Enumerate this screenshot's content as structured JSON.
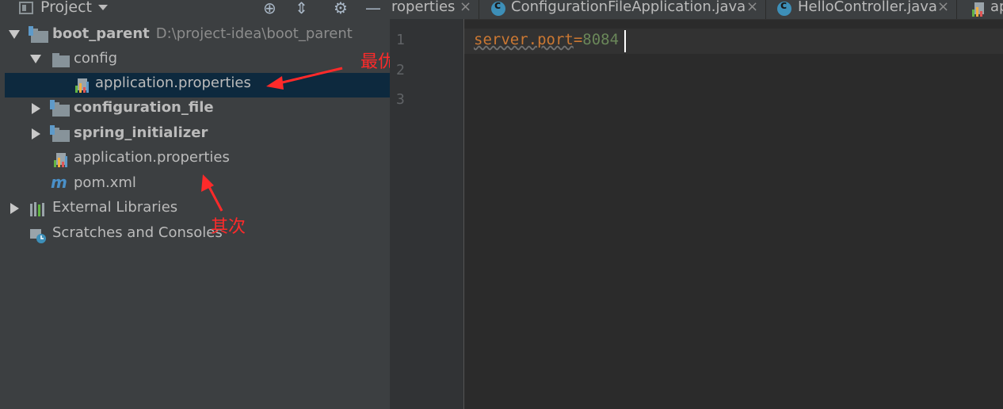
{
  "panel": {
    "title": "Project",
    "tools": [
      "locate-icon",
      "collapse-icon",
      "gear-icon",
      "minimize-icon"
    ]
  },
  "tree": [
    {
      "label": "boot_parent",
      "path": "D:\\project-idea\\boot_parent",
      "bold": true,
      "expanded": true,
      "icon": "module-folder-icon"
    },
    {
      "label": "config",
      "bold": false,
      "expanded": true,
      "icon": "folder-icon"
    },
    {
      "label": "application.properties",
      "selected": true,
      "icon": "properties-file-icon"
    },
    {
      "label": "configuration_file",
      "bold": true,
      "expanded": false,
      "icon": "module-folder-icon"
    },
    {
      "label": "spring_initializer",
      "bold": true,
      "expanded": false,
      "icon": "module-folder-icon"
    },
    {
      "label": "application.properties",
      "icon": "properties-file-icon"
    },
    {
      "label": "pom.xml",
      "icon": "maven-icon"
    },
    {
      "label": "External Libraries",
      "expanded": false,
      "icon": "libraries-icon"
    },
    {
      "label": "Scratches and Consoles",
      "icon": "scratches-icon"
    }
  ],
  "annotations": {
    "first": "最优先",
    "second": "其次",
    "color": "#ff2a2a"
  },
  "tabs": [
    {
      "label": "roperties",
      "close": "×"
    },
    {
      "label": "ConfigurationFileApplication.java",
      "close": "×"
    },
    {
      "label": "HelloController.java",
      "close": "×"
    },
    {
      "label": "ap"
    }
  ],
  "editor": {
    "line_numbers": [
      "1",
      "2",
      "3"
    ],
    "code_key": "server.port",
    "code_eq": "=",
    "code_value": "8084"
  },
  "colors": {
    "background": "#2b2b2b",
    "panel": "#3c3f41",
    "selection": "#0d293e",
    "text": "#bbbbbb"
  }
}
